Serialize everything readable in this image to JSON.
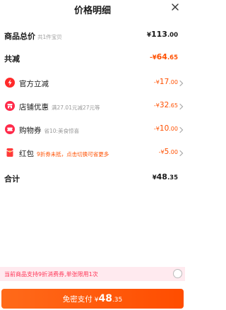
{
  "header": {
    "title": "价格明细",
    "close_icon": "close-icon"
  },
  "summary": {
    "goods_total_label": "商品总价",
    "goods_total_sub": "共1件宝贝",
    "goods_total_currency": "¥",
    "goods_total_int": "113",
    "goods_total_dec": ".00",
    "reduce_label": "共减",
    "reduce_prefix": "-¥",
    "reduce_int": "64",
    "reduce_dec": ".65"
  },
  "discounts": [
    {
      "label": "官方立减",
      "sub": "",
      "prefix": "-¥",
      "int": "17",
      "dec": ".00",
      "icon": "lightning-icon",
      "icon_color": "#ff2a2a"
    },
    {
      "label": "店铺优惠",
      "sub": "满27.01元减27元等",
      "prefix": "-¥",
      "int": "32",
      "dec": ".65",
      "icon": "store-icon",
      "icon_color": "#ff2a4a"
    },
    {
      "label": "购物券",
      "sub": "省10:美食惊喜",
      "prefix": "-¥",
      "int": "10",
      "dec": ".00",
      "icon": "ticket-icon",
      "icon_color": "#ff2a4a"
    },
    {
      "label": "红包",
      "sub": "9折券未抵，点击切换可省更多",
      "prefix": "-¥",
      "int": "5",
      "dec": ".00",
      "icon": "red-packet-icon",
      "icon_color": "#ff3a3a"
    }
  ],
  "total": {
    "label": "合计",
    "currency": "¥",
    "int": "48",
    "dec": ".35"
  },
  "notice": {
    "text": "当前商品支持9折消费券,单张限用1次"
  },
  "pay_button": {
    "label": "免密支付",
    "currency": "¥",
    "int": "48",
    "dec": ".35"
  },
  "colors": {
    "accent": "#ff5000",
    "notice_bg": "#ffeaef",
    "notice_text": "#ff3355"
  }
}
